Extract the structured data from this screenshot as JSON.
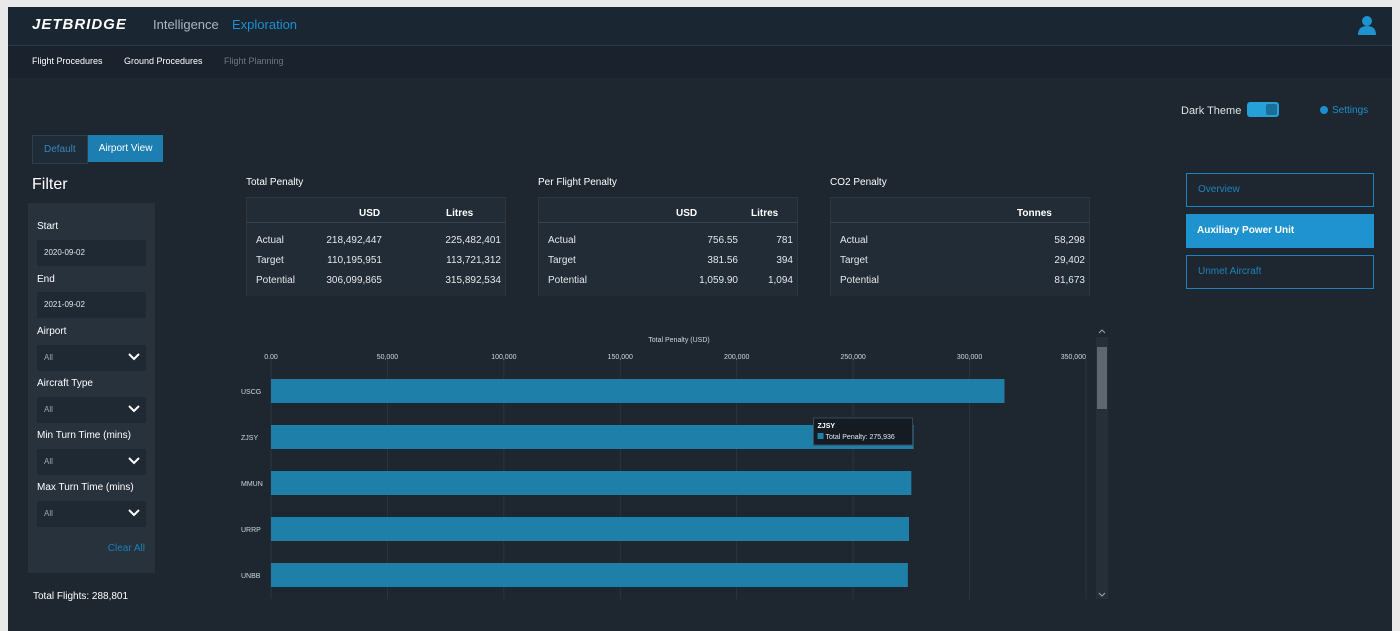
{
  "app": {
    "logo": "JETBRIDGE",
    "top_nav": [
      "Intelligence",
      "Exploration"
    ],
    "sub_nav": [
      "Flight Procedures",
      "Ground Procedures",
      "Flight Planning"
    ]
  },
  "theme": {
    "label": "Dark Theme",
    "enabled": true,
    "settings_label": "Settings"
  },
  "view_tabs": {
    "default_label": "Default",
    "airport_label": "Airport View"
  },
  "filter": {
    "title": "Filter",
    "start_label": "Start",
    "start_value": "2020-09-02",
    "end_label": "End",
    "end_value": "2021-09-02",
    "airport_label": "Airport",
    "airport_value": "All",
    "aircraft_label": "Aircraft Type",
    "aircraft_value": "All",
    "min_label": "Min Turn Time (mins)",
    "min_value": "All",
    "max_label": "Max Turn Time (mins)",
    "max_value": "All",
    "clear_label": "Clear All"
  },
  "total_flights": "Total Flights: 288,801",
  "total_penalty": {
    "title": "Total Penalty",
    "headers": [
      "USD",
      "Litres"
    ],
    "rows": [
      {
        "label": "Actual",
        "usd": "218,492,447",
        "litres": "225,482,401"
      },
      {
        "label": "Target",
        "usd": "110,195,951",
        "litres": "113,721,312"
      },
      {
        "label": "Potential",
        "usd": "306,099,865",
        "litres": "315,892,534"
      }
    ]
  },
  "per_flight_penalty": {
    "title": "Per Flight Penalty",
    "headers": [
      "USD",
      "Litres"
    ],
    "rows": [
      {
        "label": "Actual",
        "usd": "756.55",
        "litres": "781"
      },
      {
        "label": "Target",
        "usd": "381.56",
        "litres": "394"
      },
      {
        "label": "Potential",
        "usd": "1,059.90",
        "litres": "1,094"
      }
    ]
  },
  "co2_penalty": {
    "title": "CO2 Penalty",
    "headers": [
      "Tonnes"
    ],
    "rows": [
      {
        "label": "Actual",
        "tonnes": "58,298"
      },
      {
        "label": "Target",
        "tonnes": "29,402"
      },
      {
        "label": "Potential",
        "tonnes": "81,673"
      }
    ]
  },
  "right_menu": [
    "Overview",
    "Auxiliary Power Unit",
    "Unmet Aircraft"
  ],
  "colors": {
    "bar": "#1e7fa8",
    "accent": "#1f93cf",
    "background": "#1e262f"
  },
  "chart_data": {
    "type": "bar",
    "orientation": "horizontal",
    "title": "Total Penalty (USD)",
    "categories": [
      "USCG",
      "ZJSY",
      "MMUN",
      "URRP",
      "UNBB"
    ],
    "values": [
      315000,
      275936,
      275000,
      274000,
      273500
    ],
    "xlim": [
      0,
      350000
    ],
    "ticks": [
      "0.00",
      "50,000",
      "100,000",
      "150,000",
      "200,000",
      "250,000",
      "300,000",
      "350,000"
    ],
    "tooltip": {
      "category": "ZJSY",
      "text": "Total Penalty: 275,936"
    },
    "grid": true
  }
}
